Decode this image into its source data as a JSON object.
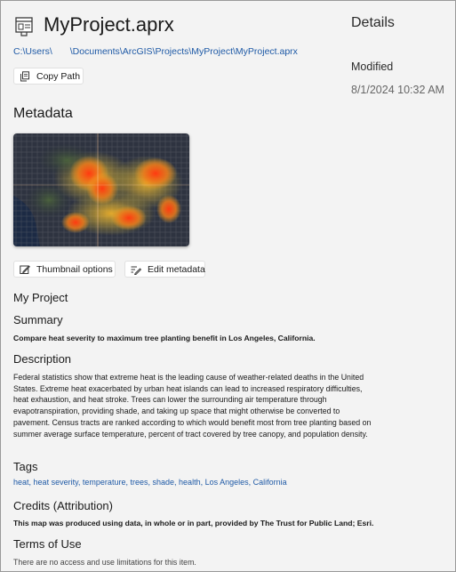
{
  "header": {
    "file_title": "MyProject.aprx",
    "path_part1": "C:\\Users\\",
    "path_part2": "\\Documents\\ArcGIS\\Projects\\MyProject\\MyProject.aprx",
    "copy_path_label": "Copy Path",
    "file_icon": "project-file-icon"
  },
  "details": {
    "title": "Details",
    "modified_label": "Modified",
    "modified_value": "8/1/2024 10:32 AM"
  },
  "metadata": {
    "heading": "Metadata",
    "thumbnail_options_label": "Thumbnail options",
    "edit_metadata_label": "Edit metadata",
    "item_title": "My Project",
    "summary_heading": "Summary",
    "summary_text": "Compare heat severity to maximum tree planting benefit in Los Angeles, California.",
    "description_heading": "Description",
    "description_text": "Federal statistics show that extreme heat is the leading cause of weather-related deaths in the United States. Extreme heat exacerbated by urban heat islands can lead to increased respiratory difficulties, heat exhaustion, and heat stroke. Trees can lower the surrounding air temperature through evapotranspiration, providing shade, and taking up space that might otherwise be converted to pavement. Census tracts are ranked according to which would benefit most from tree planting based on summer average surface temperature, percent of tract covered by tree canopy, and population density.",
    "tags_heading": "Tags",
    "tags": [
      "heat",
      "heat severity",
      "temperature",
      "trees",
      "shade",
      "health",
      "Los Angeles",
      "California"
    ],
    "credits_heading": "Credits (Attribution)",
    "credits_text": "This map was produced using data, in whole or in part, provided by The Trust for Public Land; Esri.",
    "terms_heading": "Terms of Use",
    "terms_text": "There are no access and use limitations for this item."
  },
  "colors": {
    "link": "#1f5aa6",
    "background": "#f3f3f3",
    "heat_high": "#e8491d",
    "heat_mid": "#f5a623",
    "map_dark": "#2b2f3a"
  }
}
